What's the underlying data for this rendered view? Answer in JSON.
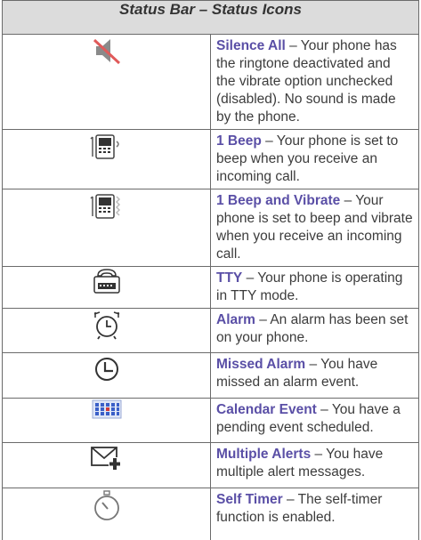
{
  "table": {
    "title": "Status Bar – Status Icons",
    "separator": " – ",
    "rows": [
      {
        "term": "Silence All",
        "desc": "Your phone has the ringtone deactivated and the vibrate option unchecked (disabled). No sound is made by the phone.",
        "icon": "silence-all-icon"
      },
      {
        "term": "1 Beep",
        "desc": "Your phone is set to beep when you receive an incoming call.",
        "icon": "one-beep-icon"
      },
      {
        "term": "1 Beep and Vibrate",
        "desc": "Your phone is set to beep and vibrate when you receive an incoming call.",
        "icon": "beep-vibrate-icon"
      },
      {
        "term": "TTY",
        "desc": "Your phone is operating in TTY mode.",
        "icon": "tty-icon"
      },
      {
        "term": "Alarm",
        "desc": "An alarm has been set on your phone.",
        "icon": "alarm-clock-icon"
      },
      {
        "term": "Missed Alarm",
        "desc": "You have missed an alarm event.",
        "icon": "missed-alarm-icon"
      },
      {
        "term": "Calendar Event",
        "desc": "You have a pending event scheduled.",
        "icon": "calendar-icon"
      },
      {
        "term": "Multiple Alerts",
        "desc": "You have multiple alert messages.",
        "icon": "envelope-plus-icon"
      },
      {
        "term": "Self Timer",
        "desc": "The self-timer function is enabled.",
        "icon": "self-timer-icon"
      }
    ]
  },
  "colors": {
    "term": "#5a4fa6",
    "body_text": "#3c3c3c",
    "header_bg": "#dcdcdc",
    "border": "#6b6b6b",
    "slash": "#e05a5a",
    "calendar_blue": "#3a5fc8"
  }
}
